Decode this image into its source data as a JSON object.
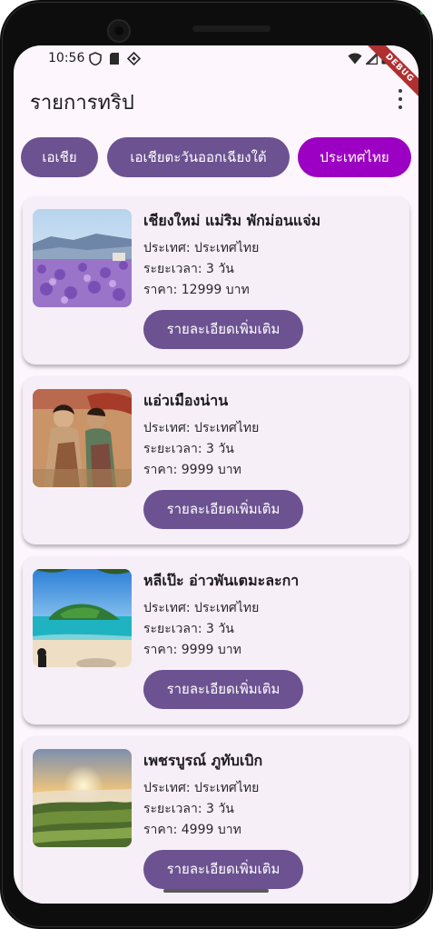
{
  "status_bar": {
    "time": "10:56",
    "debug_label": "DEBUG"
  },
  "app_bar": {
    "title": "รายการทริป"
  },
  "chips": [
    {
      "label": "เอเชีย"
    },
    {
      "label": "เอเชียตะวันออกเฉียงใต้"
    },
    {
      "label": "ประเทศไทย"
    }
  ],
  "trips": [
    {
      "title": "เชียงใหม่ แม่ริม พักม่อนแจ่ม",
      "country": "ประเทศ: ประเทศไทย",
      "duration": "ระยะเวลา: 3 วัน",
      "price": "ราคา: 12999 บาท",
      "button_label": "รายละเอียดเพิ่มเติม"
    },
    {
      "title": "แอ่วเมืองน่าน",
      "country": "ประเทศ: ประเทศไทย",
      "duration": "ระยะเวลา: 3 วัน",
      "price": "ราคา: 9999 บาท",
      "button_label": "รายละเอียดเพิ่มเติม"
    },
    {
      "title": "หลีเป๊ะ อ่าวพันเตมะละกา",
      "country": "ประเทศ: ประเทศไทย",
      "duration": "ระยะเวลา: 3 วัน",
      "price": "ราคา: 9999 บาท",
      "button_label": "รายละเอียดเพิ่มเติม"
    },
    {
      "title": "เพชรบูรณ์ ภูทับเบิก",
      "country": "ประเทศ: ประเทศไทย",
      "duration": "ระยะเวลา: 3 วัน",
      "price": "ราคา: 4999 บาท",
      "button_label": "รายละเอียดเพิ่มเติม"
    }
  ],
  "colors": {
    "primary_button": "#6c5291",
    "selected_chip": "#9c00c2",
    "card_background": "#f6eff8",
    "screen_background": "#fdf6fd"
  }
}
